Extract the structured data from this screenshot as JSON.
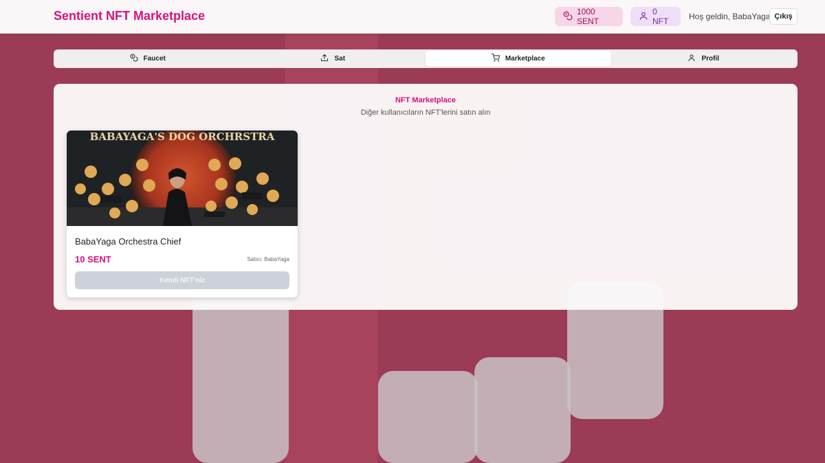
{
  "header": {
    "brand": "Sentient NFT Marketplace",
    "balance_label": "1000 SENT",
    "nft_count_label": "0 NFT",
    "welcome": "Hoş geldin, BabaYaga!",
    "logout_label": "Çıkış"
  },
  "tabs": [
    {
      "label": "Faucet",
      "icon": "coins-icon",
      "active": false
    },
    {
      "label": "Sat",
      "icon": "upload-icon",
      "active": false
    },
    {
      "label": "Marketplace",
      "icon": "cart-icon",
      "active": true
    },
    {
      "label": "Profil",
      "icon": "user-icon",
      "active": false
    }
  ],
  "marketplace": {
    "title": "NFT Marketplace",
    "subtitle": "Diğer kullanıcıların NFT'lerini satın alın",
    "items": [
      {
        "image_text": "BABAYAGA'S DOG ORCHRSTRA",
        "name": "BabaYaga Orchestra Chief",
        "price": "10 SENT",
        "seller": "Satıcı: BabaYaga",
        "button_label": "Kendi NFT'niz"
      }
    ]
  },
  "colors": {
    "brand": "#d6137f",
    "background": "#9b3b55",
    "disabled_button": "#cdd1d9"
  }
}
